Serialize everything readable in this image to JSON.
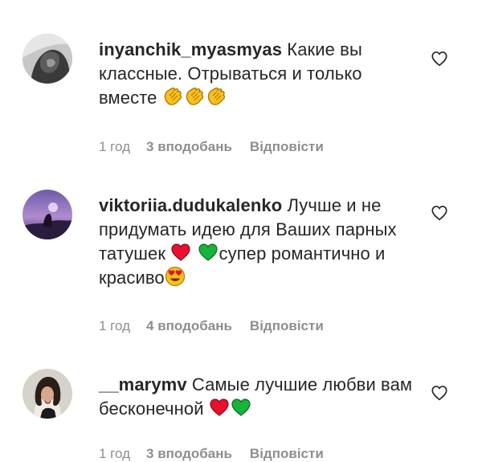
{
  "comments": [
    {
      "username": "inyanchik_myasmyas",
      "text": " Какие вы классные. Отрываться и только вместе ",
      "emoji": [
        "clapping-hands",
        "clapping-hands",
        "clapping-hands"
      ],
      "time": "1 год",
      "likes": "3 вподобань",
      "reply": "Відповісти"
    },
    {
      "username": "viktoriia.dudukalenko",
      "text_a": " Лучше и не придумать идею для Ваших парных татушек ",
      "text_b": "супер романтично и красиво",
      "emoji": [
        "red-heart",
        "green-heart",
        "heart-eyes-face"
      ],
      "time": "1 год",
      "likes": "4 вподобань",
      "reply": "Відповісти"
    },
    {
      "username": "__marymv",
      "text": " Самые лучшие любви вам бесконечной ",
      "emoji": [
        "red-heart",
        "green-heart"
      ],
      "time": "1 год",
      "likes": "3 вподобань",
      "reply": "Відповісти"
    }
  ],
  "colors": {
    "text": "#262626",
    "meta": "#8e8e8e",
    "red_heart": "#e8102e",
    "green_heart": "#16b43a",
    "clap": "#f7c11e"
  },
  "icons": {
    "like": "heart-outline-icon"
  }
}
